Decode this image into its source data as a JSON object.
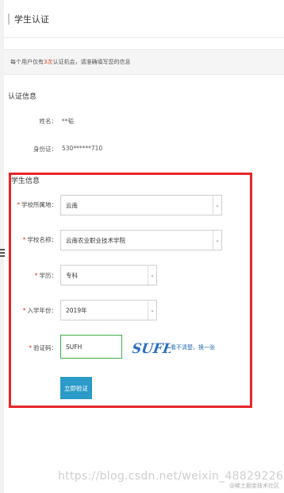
{
  "page": {
    "title": "学生认证"
  },
  "notice": {
    "before": "每个用户仅有",
    "count": "3次",
    "after": "认证机会，请准确填写您的信息"
  },
  "auth_info": {
    "section_title": "认证信息",
    "name_label": "姓名：",
    "name_value": "**韬",
    "id_label": "身份证：",
    "id_value": "530******710"
  },
  "student_info": {
    "section_title": "学生信息",
    "required_mark": "*",
    "school_region": {
      "label": "学校所属地：",
      "value": "云南"
    },
    "school_name": {
      "label": "学校名称：",
      "value": "云南农业职业技术学院"
    },
    "education": {
      "label": "学历：",
      "value": "专科"
    },
    "enroll_year": {
      "label": "入学年份：",
      "value": "2019年"
    },
    "captcha": {
      "label": "验证码：",
      "value": "SUFH",
      "image_text": "SUFH",
      "refresh_text": "看不清楚，换一张"
    },
    "submit_label": "立即验证"
  },
  "watermark": {
    "url": "https://blog.csdn.net/weixin_48829226",
    "site": "@稀土掘金技术社区"
  },
  "colors": {
    "highlight_frame": "#e8262a",
    "button": "#2b9bc9",
    "captcha_border": "#3fae49",
    "required": "#d9342b"
  }
}
